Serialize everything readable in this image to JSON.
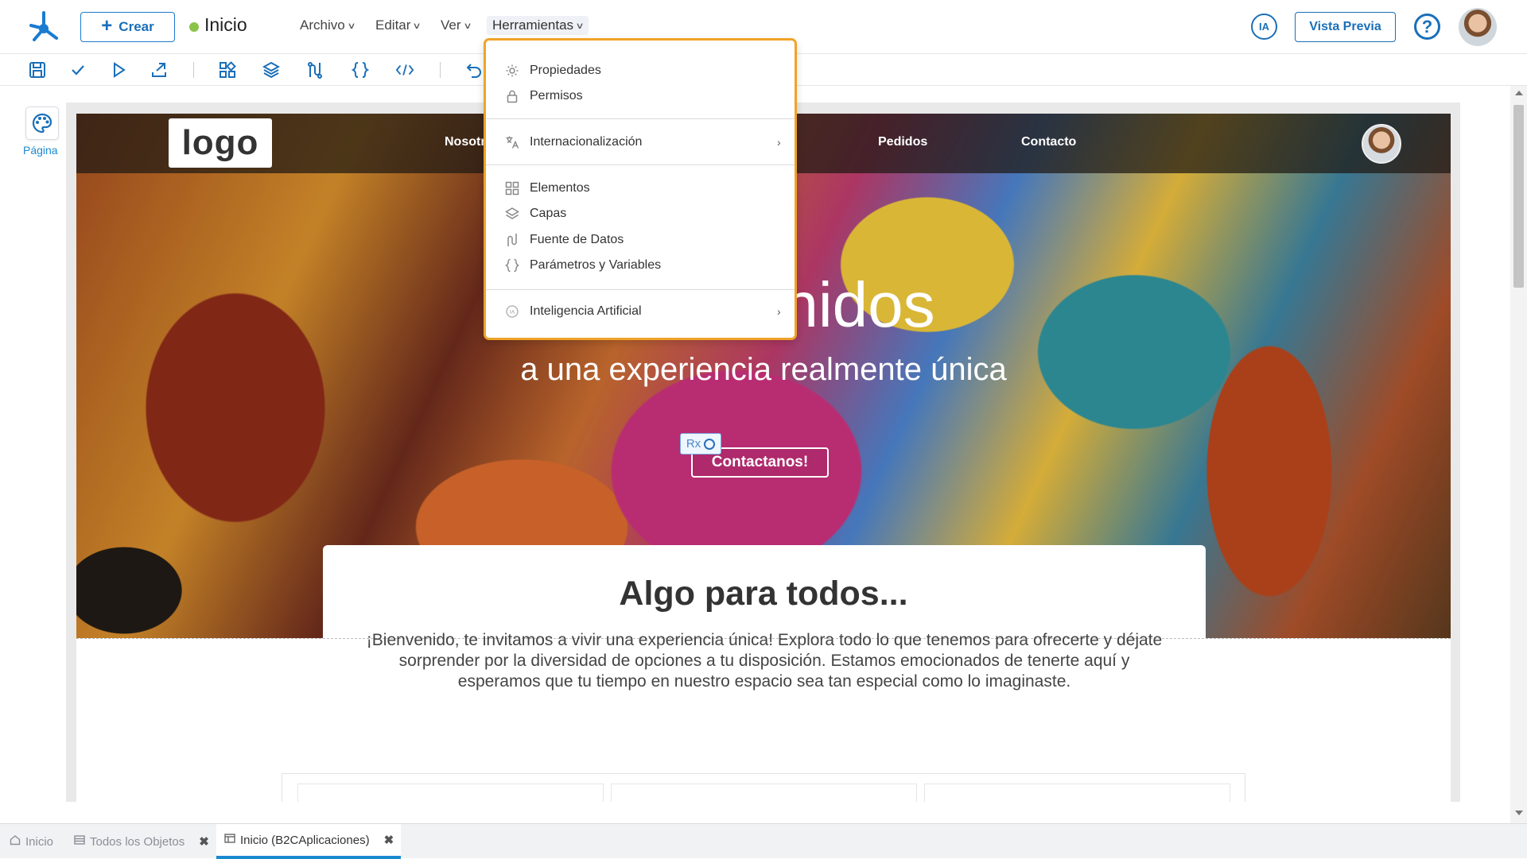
{
  "header": {
    "create_label": "Crear",
    "page_name": "Inicio",
    "menus": [
      {
        "label": "Archivo"
      },
      {
        "label": "Editar"
      },
      {
        "label": "Ver"
      },
      {
        "label": "Herramientas"
      }
    ],
    "ia_label": "IA",
    "preview_label": "Vista Previa",
    "help_label": "?"
  },
  "left_panel": {
    "page_label": "Página"
  },
  "canvas": {
    "logo_text": "logo",
    "nav_links": [
      "Nosotros",
      "Pedidos",
      "Contacto"
    ],
    "hero_title": "Bienvenidos",
    "hero_title_visible": "nidos",
    "hero_subtitle": "a una experiencia realmente única",
    "rx_label": "Rx",
    "hero_button": "Contactanos!",
    "section_title": "Algo para todos...",
    "section_text": "¡Bienvenido, te invitamos a vivir una experiencia única! Explora todo lo que tenemos para ofrecerte y déjate sorprender por la diversidad de opciones a tu disposición. Estamos emocionados de tenerte aquí y esperamos que tu tiempo en nuestro espacio sea tan especial como lo imaginaste."
  },
  "dropdown": {
    "items": [
      {
        "label": "Propiedades",
        "icon": "gear-icon"
      },
      {
        "label": "Permisos",
        "icon": "lock-icon"
      },
      {
        "label": "Internacionalización",
        "icon": "translate-icon",
        "submenu": true
      },
      {
        "label": "Elementos",
        "icon": "grid-icon"
      },
      {
        "label": "Capas",
        "icon": "layers-icon"
      },
      {
        "label": "Fuente de Datos",
        "icon": "datasource-icon"
      },
      {
        "label": "Parámetros y Variables",
        "icon": "braces-icon"
      },
      {
        "label": "Inteligencia Artificial",
        "icon": "ai-icon",
        "submenu": true
      }
    ]
  },
  "tabs": [
    {
      "label": "Inicio",
      "icon": "home-icon"
    },
    {
      "label": "Todos los Objetos",
      "icon": "list-icon",
      "closable": true
    },
    {
      "label": "Inicio (B2CAplicaciones)",
      "icon": "page-icon",
      "closable": true,
      "active": true
    }
  ],
  "colors": {
    "accent": "#1a6fb8",
    "menu_highlight": "#f0a329",
    "status_dot": "#8bc34a",
    "active_tab_bar": "#1a8ad0"
  }
}
